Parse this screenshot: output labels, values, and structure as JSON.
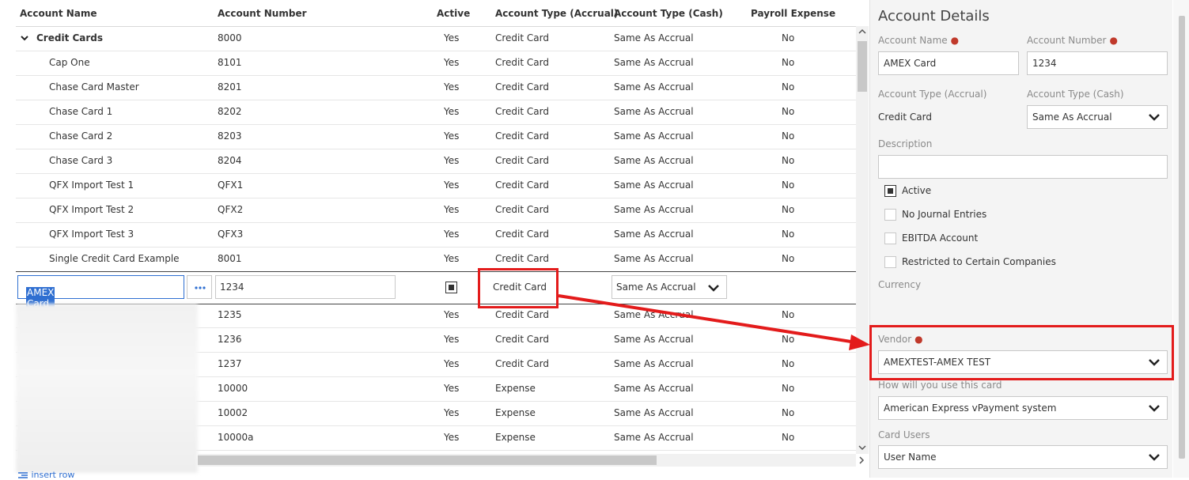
{
  "grid": {
    "headers": {
      "name": "Account Name",
      "number": "Account Number",
      "active": "Active",
      "accrual": "Account Type (Accrual)",
      "cash": "Account Type (Cash)",
      "payroll": "Payroll Expense"
    },
    "group": {
      "name": "Credit Cards",
      "number": "8000",
      "active": "Yes",
      "accrual": "Credit Card",
      "cash": "Same As Accrual",
      "payroll": "No"
    },
    "rows": [
      {
        "name": "Cap One",
        "number": "8101",
        "active": "Yes",
        "accrual": "Credit Card",
        "cash": "Same As Accrual",
        "payroll": "No"
      },
      {
        "name": "Chase Card Master",
        "number": "8201",
        "active": "Yes",
        "accrual": "Credit Card",
        "cash": "Same As Accrual",
        "payroll": "No"
      },
      {
        "name": "Chase Card 1",
        "number": "8202",
        "active": "Yes",
        "accrual": "Credit Card",
        "cash": "Same As Accrual",
        "payroll": "No"
      },
      {
        "name": "Chase Card 2",
        "number": "8203",
        "active": "Yes",
        "accrual": "Credit Card",
        "cash": "Same As Accrual",
        "payroll": "No"
      },
      {
        "name": "Chase Card 3",
        "number": "8204",
        "active": "Yes",
        "accrual": "Credit Card",
        "cash": "Same As Accrual",
        "payroll": "No"
      },
      {
        "name": "QFX Import Test 1",
        "number": "QFX1",
        "active": "Yes",
        "accrual": "Credit Card",
        "cash": "Same As Accrual",
        "payroll": "No"
      },
      {
        "name": "QFX Import Test 2",
        "number": "QFX2",
        "active": "Yes",
        "accrual": "Credit Card",
        "cash": "Same As Accrual",
        "payroll": "No"
      },
      {
        "name": "QFX Import Test 3",
        "number": "QFX3",
        "active": "Yes",
        "accrual": "Credit Card",
        "cash": "Same As Accrual",
        "payroll": "No"
      },
      {
        "name": "Single Credit Card Example",
        "number": "8001",
        "active": "Yes",
        "accrual": "Credit Card",
        "cash": "Same As Accrual",
        "payroll": "No"
      }
    ],
    "edit_row": {
      "name": "AMEX Card",
      "number": "1234",
      "accrual": "Credit Card",
      "cash": "Same As Accrual"
    },
    "lower_rows": [
      {
        "name": "",
        "number": "1235",
        "active": "Yes",
        "accrual": "Credit Card",
        "cash": "Same As Accrual",
        "payroll": "No"
      },
      {
        "name": "",
        "number": "1236",
        "active": "Yes",
        "accrual": "Credit Card",
        "cash": "Same As Accrual",
        "payroll": "No"
      },
      {
        "name": "",
        "number": "1237",
        "active": "Yes",
        "accrual": "Credit Card",
        "cash": "Same As Accrual",
        "payroll": "No"
      },
      {
        "name": "",
        "number": "10000",
        "active": "Yes",
        "accrual": "Expense",
        "cash": "Same As Accrual",
        "payroll": "No"
      },
      {
        "name": "",
        "number": "10002",
        "active": "Yes",
        "accrual": "Expense",
        "cash": "Same As Accrual",
        "payroll": "No"
      },
      {
        "name": "",
        "number": "10000a",
        "active": "Yes",
        "accrual": "Expense",
        "cash": "Same As Accrual",
        "payroll": "No"
      }
    ],
    "insert_row_label": "insert row"
  },
  "panel": {
    "title": "Account Details",
    "account_name_label": "Account Name",
    "account_name_value": "AMEX Card",
    "account_number_label": "Account Number",
    "account_number_value": "1234",
    "accrual_label": "Account Type (Accrual)",
    "accrual_value": "Credit Card",
    "cash_label": "Account Type (Cash)",
    "cash_value": "Same As Accrual",
    "description_label": "Description",
    "description_value": "",
    "checkboxes": [
      {
        "label": "Active",
        "checked": true
      },
      {
        "label": "No Journal Entries",
        "checked": false
      },
      {
        "label": "EBITDA Account",
        "checked": false
      },
      {
        "label": "Restricted to Certain Companies",
        "checked": false
      }
    ],
    "currency_label": "Currency",
    "vendor_label": "Vendor",
    "vendor_value": "AMEXTEST-AMEX TEST",
    "usage_label": "How will you use this card",
    "usage_value": "American Express vPayment system",
    "card_users_label": "Card Users",
    "card_users_value": "User Name"
  },
  "colors": {
    "annotation": "#e31b1b",
    "selection": "#2f6fd1",
    "required": "#c0392b"
  }
}
